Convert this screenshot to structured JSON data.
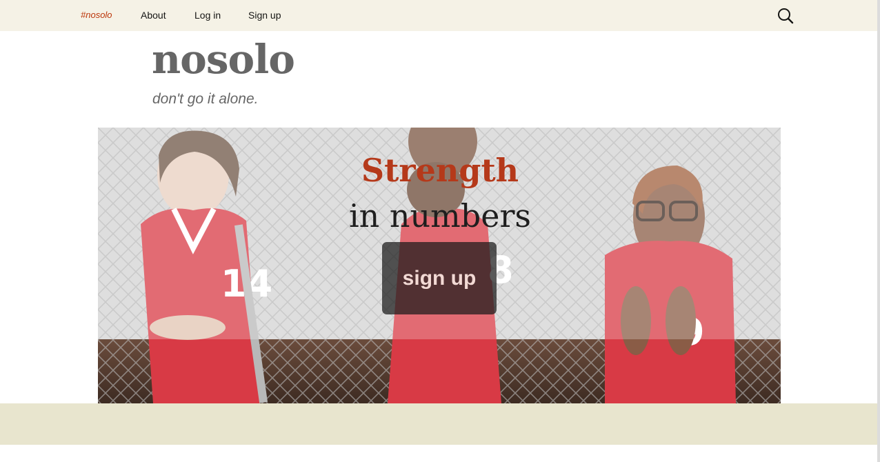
{
  "nav": {
    "brand_label": "#nosolo",
    "items": [
      {
        "label": "About"
      },
      {
        "label": "Log in"
      },
      {
        "label": "Sign up"
      }
    ]
  },
  "icons": {
    "search": "search-icon"
  },
  "site": {
    "title": "nosolo",
    "tagline": "don't go it alone."
  },
  "hero": {
    "headline": "Strength",
    "subline": "in numbers",
    "cta_label": "sign up"
  },
  "colors": {
    "nav_background": "#f5f2e6",
    "brand_accent": "#bc360a",
    "headline": "#b5391a",
    "footer_band": "#e8e5ce",
    "title_gray": "#666666"
  }
}
